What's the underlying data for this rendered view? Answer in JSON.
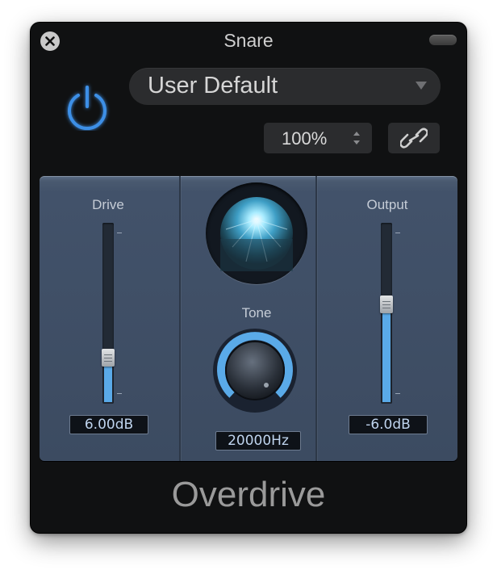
{
  "window": {
    "title": "Snare",
    "plugin_name": "Overdrive"
  },
  "header": {
    "preset": "User Default",
    "zoom": "100%"
  },
  "controls": {
    "drive": {
      "label": "Drive",
      "value_text": "6.00dB",
      "level": 0.25
    },
    "tone": {
      "label": "Tone",
      "value_text": "20000Hz",
      "level": 1.0
    },
    "output": {
      "label": "Output",
      "value_text": "-6.0dB",
      "level": 0.55
    }
  },
  "colors": {
    "accent": "#5aaae8",
    "power": "#3d8fe6",
    "panel": "#42526a"
  },
  "icons": [
    "close-icon",
    "power-icon",
    "chevron-down-icon",
    "stepper-icon",
    "link-icon"
  ]
}
